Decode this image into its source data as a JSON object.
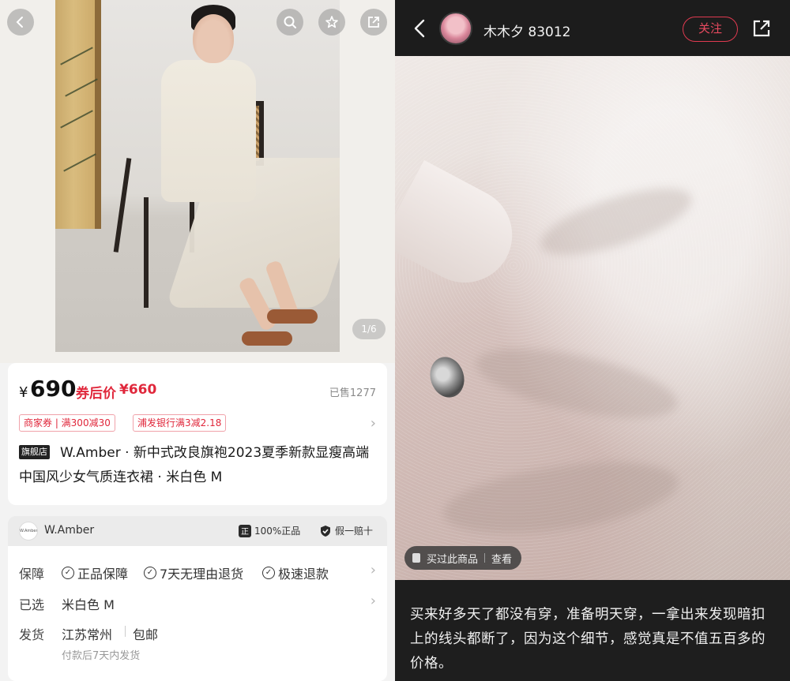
{
  "product": {
    "image_counter": "1/6",
    "currency": "¥",
    "price": "690",
    "coupon_label": "券后价",
    "coupon_price": "¥660",
    "sold": "已售1277",
    "tags": [
      "商家券 | 满300减30",
      "浦发银行满3减2.18"
    ],
    "store_badge": "旗舰店",
    "title": "W.Amber · 新中式改良旗袍2023夏季新款显瘦高端中国风少女气质连衣裙 · 米白色 M"
  },
  "store": {
    "logo_text": "W.Amber",
    "name": "W.Amber",
    "auth_genuine_icon": "正",
    "auth_genuine": "100%正品",
    "auth_fake": "假一赔十"
  },
  "info": {
    "guarantee_label": "保障",
    "guarantees": [
      "正品保障",
      "7天无理由退货",
      "极速退款"
    ],
    "selected_label": "已选",
    "selected_value": "米白色 M",
    "ship_label": "发货",
    "ship_from": "江苏常州",
    "ship_free": "包邮",
    "ship_note": "付款后7天内发货"
  },
  "review": {
    "username": "木木夕 83012",
    "follow": "关注",
    "bought_label": "买过此商品",
    "view_label": "查看",
    "text": "买来好多天了都没有穿，准备明天穿，一拿出来发现暗扣上的线头都断了，因为这个细节，感觉真是不值五百多的价格。"
  },
  "colors": {
    "accent_red": "#e0273b",
    "dark_bg": "#1e1e1e"
  },
  "icons": {
    "back": "chevron-left-icon",
    "search": "search-icon",
    "favorite": "star-icon",
    "share": "share-icon",
    "check": "check-circle-icon",
    "chevron": "chevron-right-icon"
  }
}
